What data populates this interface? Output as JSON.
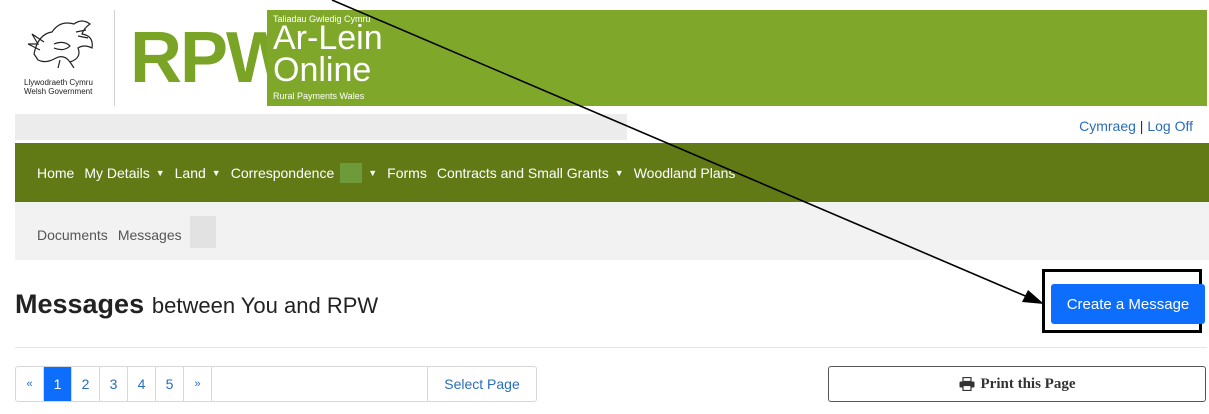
{
  "header": {
    "gov_text_cy": "Llywodraeth Cymru",
    "gov_text_en": "Welsh Government",
    "rpw": "RPW",
    "banner_top": "Taliadau Gwledig Cymru",
    "banner_ar": "Ar-Lein",
    "banner_online": "Online",
    "banner_bottom": "Rural Payments Wales",
    "green": "#7fa82a"
  },
  "userbar": {
    "cymraeg": "Cymraeg",
    "separator": "|",
    "logoff": "Log Off"
  },
  "nav": {
    "items": [
      "Home",
      "My Details",
      "Land",
      "Correspondence",
      "Forms",
      "Contracts and Small Grants",
      "Woodland Plans"
    ],
    "bg": "#617a15"
  },
  "subnav": {
    "items": [
      "Documents",
      "Messages"
    ]
  },
  "page": {
    "title_main": "Messages",
    "title_sub": "between You and RPW",
    "create_label": "Create a Message",
    "print_label": "Print this Page"
  },
  "pagination": {
    "prev": "«",
    "pages": [
      "1",
      "2",
      "3",
      "4",
      "5"
    ],
    "next": "»",
    "select": "Select Page",
    "current": "1"
  },
  "icons": {
    "dragon": "welsh-dragon-icon",
    "print": "printer-icon",
    "caret": "caret-down-icon"
  }
}
